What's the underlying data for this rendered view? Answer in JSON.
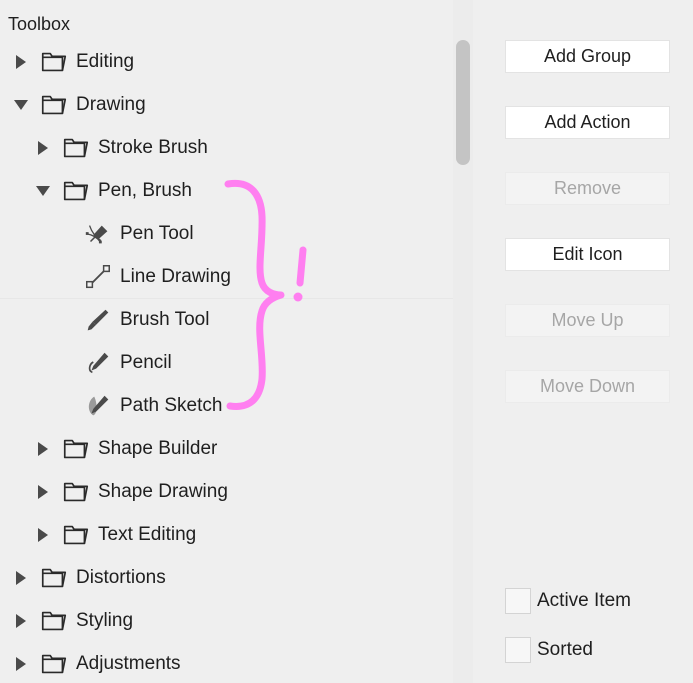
{
  "panel": {
    "title": "Toolbox"
  },
  "tree": {
    "items": [
      {
        "label": "Editing",
        "icon": "folder-icon",
        "depth": 0,
        "twisty": "collapsed",
        "separator": false
      },
      {
        "label": "Drawing",
        "icon": "folder-icon",
        "depth": 0,
        "twisty": "expanded",
        "separator": false
      },
      {
        "label": "Stroke Brush",
        "icon": "folder-icon",
        "depth": 1,
        "twisty": "collapsed",
        "separator": false
      },
      {
        "label": "Pen, Brush",
        "icon": "folder-icon",
        "depth": 1,
        "twisty": "expanded",
        "separator": false
      },
      {
        "label": "Pen Tool",
        "icon": "pen-tool-icon",
        "depth": 2,
        "twisty": "none",
        "separator": false
      },
      {
        "label": "Line Drawing",
        "icon": "line-drawing-icon",
        "depth": 2,
        "twisty": "none",
        "separator": false
      },
      {
        "label": "Brush Tool",
        "icon": "brush-tool-icon",
        "depth": 2,
        "twisty": "none",
        "separator": true
      },
      {
        "label": "Pencil",
        "icon": "pencil-icon",
        "depth": 2,
        "twisty": "none",
        "separator": false
      },
      {
        "label": "Path Sketch",
        "icon": "path-sketch-icon",
        "depth": 2,
        "twisty": "none",
        "separator": false
      },
      {
        "label": "Shape Builder",
        "icon": "folder-icon",
        "depth": 1,
        "twisty": "collapsed",
        "separator": false
      },
      {
        "label": "Shape Drawing",
        "icon": "folder-icon",
        "depth": 1,
        "twisty": "collapsed",
        "separator": false
      },
      {
        "label": "Text Editing",
        "icon": "folder-icon",
        "depth": 1,
        "twisty": "collapsed",
        "separator": false
      },
      {
        "label": "Distortions",
        "icon": "folder-icon",
        "depth": 0,
        "twisty": "collapsed",
        "separator": false
      },
      {
        "label": "Styling",
        "icon": "folder-icon",
        "depth": 0,
        "twisty": "collapsed",
        "separator": false
      },
      {
        "label": "Adjustments",
        "icon": "folder-icon",
        "depth": 0,
        "twisty": "collapsed",
        "separator": false
      }
    ]
  },
  "scrollbar": {
    "orientation": "vertical"
  },
  "buttons": {
    "add_group": {
      "label": "Add Group",
      "enabled": true
    },
    "add_action": {
      "label": "Add Action",
      "enabled": true
    },
    "remove": {
      "label": "Remove",
      "enabled": false
    },
    "edit_icon": {
      "label": "Edit Icon",
      "enabled": true
    },
    "move_up": {
      "label": "Move Up",
      "enabled": false
    },
    "move_down": {
      "label": "Move Down",
      "enabled": false
    }
  },
  "checkboxes": {
    "active_item": {
      "label": "Active Item",
      "checked": false
    },
    "sorted": {
      "label": "Sorted",
      "checked": false
    }
  },
  "annotation": {
    "color": "#ff7ff0",
    "mark": "exclamation-mark",
    "shape": "curly-brace"
  },
  "colors": {
    "background": "#efefef",
    "scroll_track": "#ececec",
    "scroll_thumb": "#c4c4c4",
    "button_face": "#ffffff",
    "button_disabled_face": "#f3f3f3",
    "text": "#1f1f1f",
    "text_disabled": "#a6a6a6",
    "icon": "#4a4a4a",
    "annotation_pink": "#ff7ff0"
  }
}
